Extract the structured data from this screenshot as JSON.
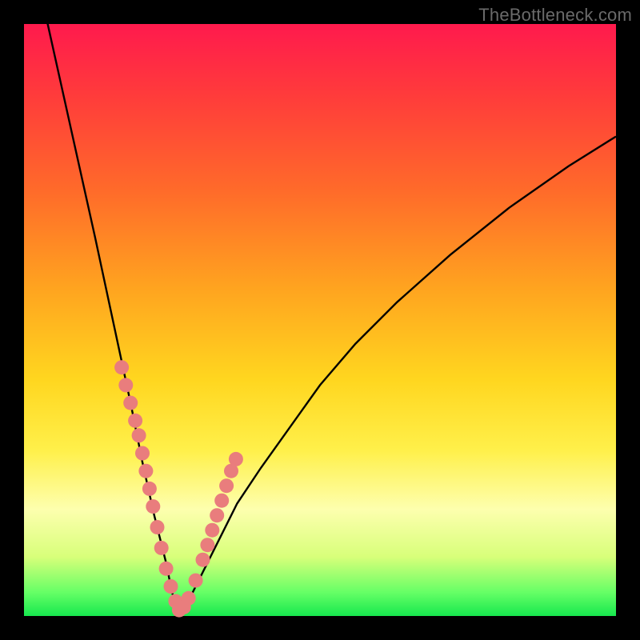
{
  "watermark": "TheBottleneck.com",
  "chart_data": {
    "type": "line",
    "title": "",
    "xlabel": "",
    "ylabel": "",
    "xlim": [
      0,
      100
    ],
    "ylim": [
      0,
      100
    ],
    "curve": {
      "comment": "Approximate bottleneck %. Minimum ≈ x=26 where value≈0; rises steeply left, gently right.",
      "x": [
        0,
        4,
        8,
        12,
        15,
        18,
        20,
        22,
        24,
        25,
        26,
        27,
        28,
        30,
        33,
        36,
        40,
        45,
        50,
        56,
        63,
        72,
        82,
        92,
        100
      ],
      "values": [
        120,
        100,
        82,
        64,
        50,
        36,
        26,
        17,
        9,
        4,
        1,
        1,
        3,
        7,
        13,
        19,
        25,
        32,
        39,
        46,
        53,
        61,
        69,
        76,
        81
      ]
    },
    "scatter_points": {
      "comment": "Sample dots clustered near the trough on both branches.",
      "x": [
        16.5,
        17.2,
        18.0,
        18.8,
        19.4,
        20.0,
        20.6,
        21.2,
        21.8,
        22.5,
        23.2,
        24.0,
        24.8,
        25.6,
        26.2,
        27.0,
        27.8,
        29.0,
        30.2,
        31.0,
        31.8,
        32.6,
        33.4,
        34.2,
        35.0,
        35.8
      ],
      "y": [
        42.0,
        39.0,
        36.0,
        33.0,
        30.5,
        27.5,
        24.5,
        21.5,
        18.5,
        15.0,
        11.5,
        8.0,
        5.0,
        2.5,
        1.0,
        1.5,
        3.0,
        6.0,
        9.5,
        12.0,
        14.5,
        17.0,
        19.5,
        22.0,
        24.5,
        26.5
      ]
    }
  }
}
